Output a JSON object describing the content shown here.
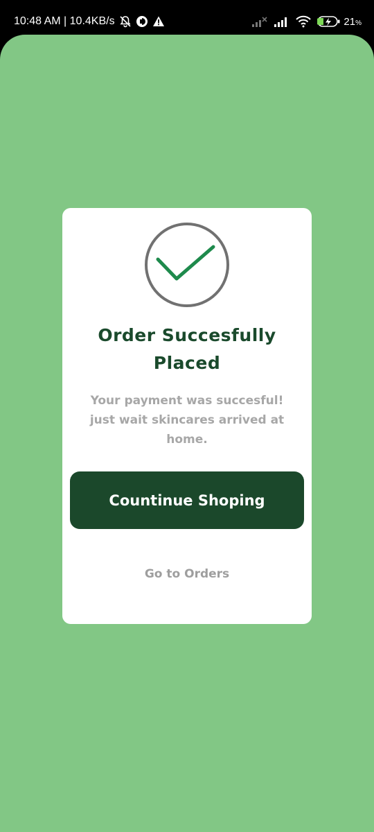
{
  "status_bar": {
    "time_speed": "10:48 AM | 10.4KB/s",
    "battery_level": "21",
    "battery_unit": "%",
    "icons": [
      "mute-bell-icon",
      "privacy-icon",
      "warning-icon",
      "signal-no-service-icon",
      "signal-icon",
      "wifi-icon",
      "battery-charging-icon"
    ]
  },
  "colors": {
    "background": "#82c785",
    "card": "#ffffff",
    "title": "#1a4a2c",
    "button": "#1b482b",
    "check": "#1e8a4c",
    "muted_text": "#a7a7a7"
  },
  "dialog": {
    "icon": "check-circle-icon",
    "title": "Order Succesfully Placed",
    "message": "Your payment was succesful! just wait skincares arrived at home.",
    "primary_button": "Countinue Shoping",
    "secondary_link": "Go to Orders"
  }
}
